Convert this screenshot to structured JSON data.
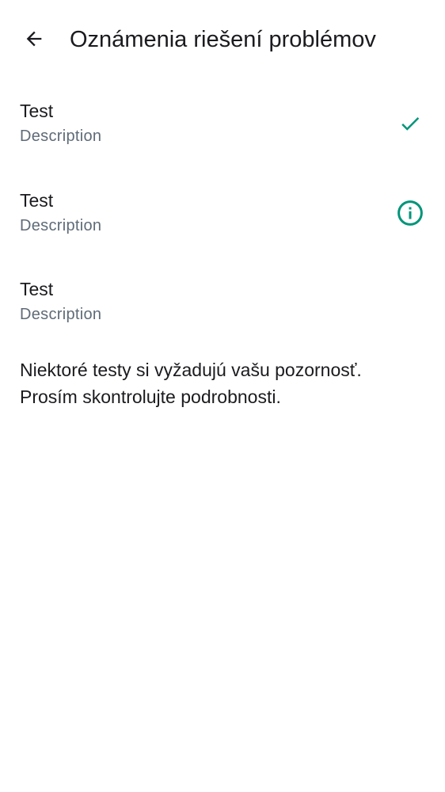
{
  "header": {
    "title": "Oznámenia riešení problémov",
    "back_icon": "arrow-left-icon"
  },
  "tests": [
    {
      "title": "Test",
      "description": "Description",
      "status": "passed",
      "status_icon": "check-icon"
    },
    {
      "title": "Test",
      "description": "Description",
      "status": "attention",
      "status_icon": "info-circle-icon"
    },
    {
      "title": "Test",
      "description": "Description",
      "status": "none",
      "status_icon": ""
    }
  ],
  "notice": {
    "line1": "Niektoré testy si vyžadujú vašu pozornosť.",
    "line2": "Prosím skontrolujte podrobnosti."
  },
  "colors": {
    "accent": "#00957a",
    "text_primary": "#1b1b1f",
    "text_secondary": "#5f6b78",
    "background": "#ffffff"
  }
}
